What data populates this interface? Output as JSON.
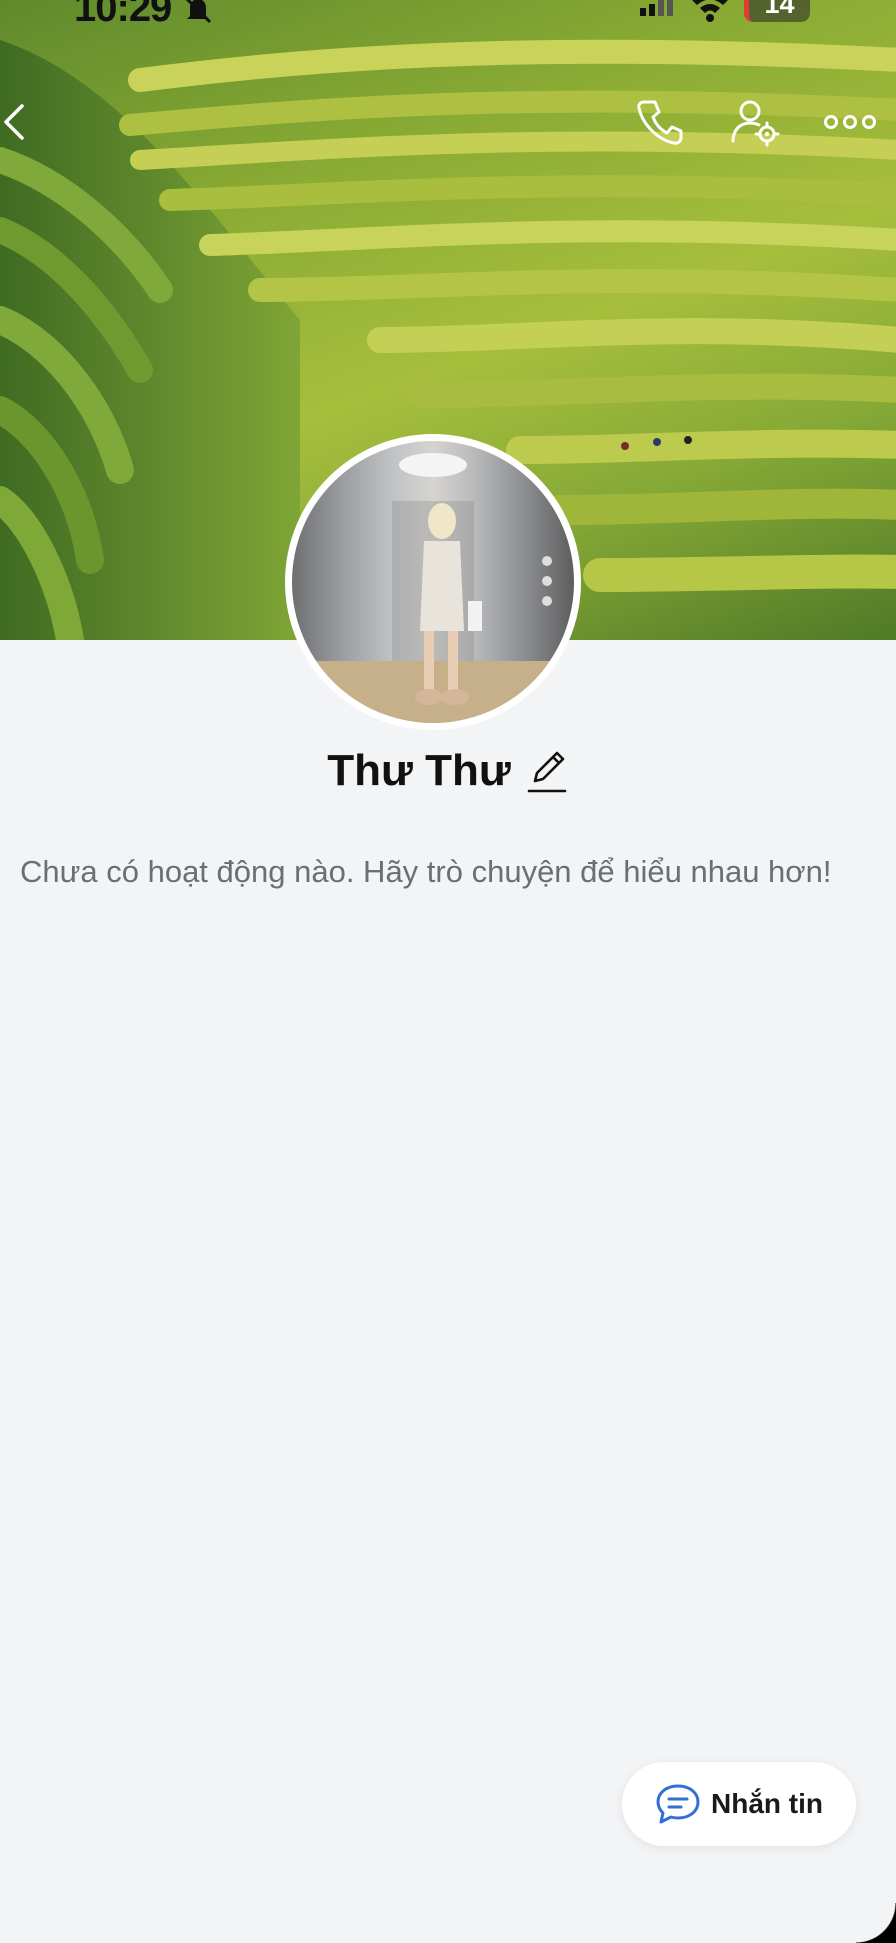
{
  "status_bar": {
    "time": "10:29",
    "battery": "14",
    "icons": [
      "bell-muted-icon",
      "signal-icon",
      "wifi-icon",
      "battery-icon"
    ]
  },
  "top_bar": {
    "icons": [
      "back-icon",
      "phone-icon",
      "user-settings-icon",
      "more-icon"
    ]
  },
  "profile": {
    "name": "Thư Thư",
    "empty_message": "Chưa có hoạt động nào. Hãy trò chuyện để hiểu nhau hơn!"
  },
  "actions": {
    "message_label": "Nhắn tin"
  },
  "colors": {
    "background": "#f3f4f6",
    "accent": "#2f6fd6",
    "text": "#111111",
    "muted_text": "#6b6f75"
  }
}
